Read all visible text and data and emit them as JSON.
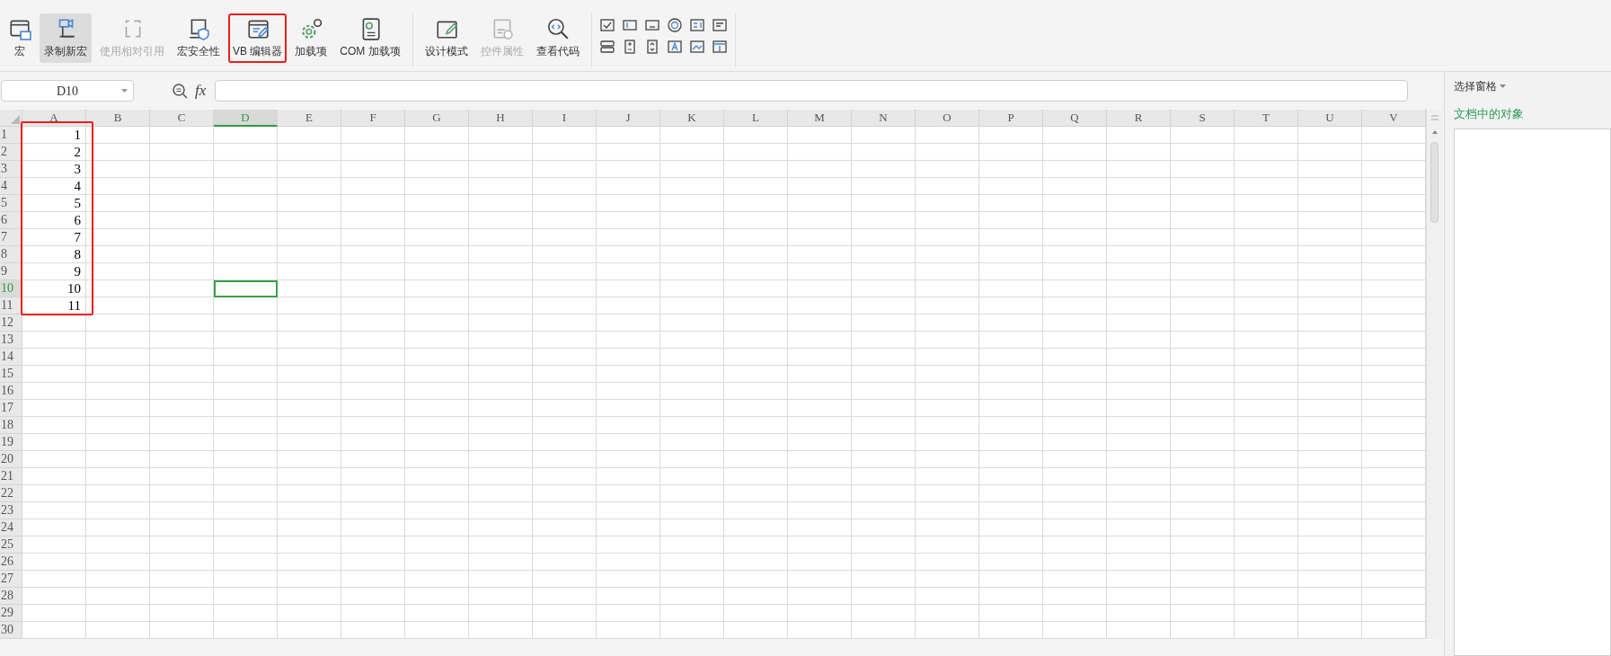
{
  "ribbon": {
    "groups": [
      {
        "buttons": [
          {
            "label": "宏",
            "selected": false,
            "disabled": false,
            "highlighted": false
          },
          {
            "label": "录制新宏",
            "selected": true,
            "disabled": false,
            "highlighted": false
          },
          {
            "label": "使用相对引用",
            "selected": false,
            "disabled": true,
            "highlighted": false
          },
          {
            "label": "宏安全性",
            "selected": false,
            "disabled": false,
            "highlighted": false
          },
          {
            "label": "VB 编辑器",
            "selected": false,
            "disabled": false,
            "highlighted": true
          },
          {
            "label": "加载项",
            "selected": false,
            "disabled": false,
            "highlighted": false
          },
          {
            "label": "COM 加载项",
            "selected": false,
            "disabled": false,
            "highlighted": false
          }
        ]
      },
      {
        "buttons": [
          {
            "label": "设计模式",
            "selected": false,
            "disabled": false,
            "highlighted": false
          },
          {
            "label": "控件属性",
            "selected": false,
            "disabled": true,
            "highlighted": false
          },
          {
            "label": "查看代码",
            "selected": false,
            "disabled": false,
            "highlighted": false
          }
        ]
      }
    ]
  },
  "name_box": {
    "value": "D10"
  },
  "formula_bar": {
    "function_label": "fx"
  },
  "sheet": {
    "columns": [
      {
        "label": "A",
        "selected": false,
        "framed": true
      },
      {
        "label": "B",
        "selected": false
      },
      {
        "label": "C",
        "selected": false
      },
      {
        "label": "D",
        "selected": true
      },
      {
        "label": "E",
        "selected": false
      },
      {
        "label": "F",
        "selected": false
      },
      {
        "label": "G",
        "selected": false
      },
      {
        "label": "H",
        "selected": false
      },
      {
        "label": "I",
        "selected": false
      },
      {
        "label": "J",
        "selected": false
      },
      {
        "label": "K",
        "selected": false
      },
      {
        "label": "L",
        "selected": false
      },
      {
        "label": "M",
        "selected": false
      },
      {
        "label": "N",
        "selected": false
      },
      {
        "label": "O",
        "selected": false
      },
      {
        "label": "P",
        "selected": false
      },
      {
        "label": "Q",
        "selected": false
      },
      {
        "label": "R",
        "selected": false
      },
      {
        "label": "S",
        "selected": false
      },
      {
        "label": "T",
        "selected": false
      },
      {
        "label": "U",
        "selected": false
      },
      {
        "label": "V",
        "selected": false
      }
    ],
    "rows": [
      {
        "label": "1",
        "selected": false,
        "cells": [
          "1"
        ]
      },
      {
        "label": "2",
        "selected": false,
        "cells": [
          "2"
        ]
      },
      {
        "label": "3",
        "selected": false,
        "cells": [
          "3"
        ]
      },
      {
        "label": "4",
        "selected": false,
        "cells": [
          "4"
        ]
      },
      {
        "label": "5",
        "selected": false,
        "cells": [
          "5"
        ]
      },
      {
        "label": "6",
        "selected": false,
        "cells": [
          "6"
        ]
      },
      {
        "label": "7",
        "selected": false,
        "cells": [
          "7"
        ]
      },
      {
        "label": "8",
        "selected": false,
        "cells": [
          "8"
        ]
      },
      {
        "label": "9",
        "selected": false,
        "cells": [
          "9"
        ]
      },
      {
        "label": "10",
        "selected": true,
        "cells": [
          "10"
        ]
      },
      {
        "label": "11",
        "selected": false,
        "cells": [
          "11"
        ]
      },
      {
        "label": "12",
        "selected": false
      },
      {
        "label": "13",
        "selected": false
      },
      {
        "label": "14",
        "selected": false
      },
      {
        "label": "15",
        "selected": false
      },
      {
        "label": "16",
        "selected": false
      },
      {
        "label": "17",
        "selected": false
      },
      {
        "label": "18",
        "selected": false
      },
      {
        "label": "19",
        "selected": false
      },
      {
        "label": "20",
        "selected": false
      },
      {
        "label": "21",
        "selected": false
      },
      {
        "label": "22",
        "selected": false
      },
      {
        "label": "23",
        "selected": false
      },
      {
        "label": "24",
        "selected": false
      },
      {
        "label": "25",
        "selected": false
      },
      {
        "label": "26",
        "selected": false
      },
      {
        "label": "27",
        "selected": false
      },
      {
        "label": "28",
        "selected": false
      },
      {
        "label": "29",
        "selected": false
      },
      {
        "label": "30",
        "selected": false
      }
    ]
  },
  "selection_pane": {
    "title": "选择窗格",
    "section": "文档中的对象"
  }
}
